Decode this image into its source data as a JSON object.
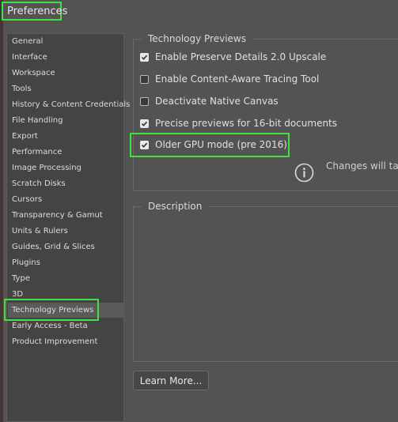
{
  "window": {
    "title": "Preferences"
  },
  "sidebar": {
    "items": [
      {
        "label": "General"
      },
      {
        "label": "Interface"
      },
      {
        "label": "Workspace"
      },
      {
        "label": "Tools"
      },
      {
        "label": "History & Content Credentials"
      },
      {
        "label": "File Handling"
      },
      {
        "label": "Export"
      },
      {
        "label": "Performance"
      },
      {
        "label": "Image Processing"
      },
      {
        "label": "Scratch Disks"
      },
      {
        "label": "Cursors"
      },
      {
        "label": "Transparency & Gamut"
      },
      {
        "label": "Units & Rulers"
      },
      {
        "label": "Guides, Grid & Slices"
      },
      {
        "label": "Plugins"
      },
      {
        "label": "Type"
      },
      {
        "label": "3D"
      },
      {
        "label": "Technology Previews",
        "selected": true
      },
      {
        "label": "Early Access - Beta"
      },
      {
        "label": "Product Improvement"
      }
    ]
  },
  "tech_previews": {
    "title": "Technology Previews",
    "options": [
      {
        "label": "Enable Preserve Details 2.0 Upscale",
        "checked": true
      },
      {
        "label": "Enable Content-Aware Tracing Tool",
        "checked": false
      },
      {
        "label": "Deactivate Native Canvas",
        "checked": false
      },
      {
        "label": "Precise previews for 16-bit documents",
        "checked": true
      },
      {
        "label": "Older GPU mode (pre 2016)",
        "checked": true
      }
    ],
    "info_text": "Changes will tak",
    "info_icon": "info-circle-icon"
  },
  "description": {
    "title": "Description"
  },
  "buttons": {
    "learn_more": "Learn More..."
  },
  "colors": {
    "highlight": "#3fe23f",
    "background": "#535353",
    "panel": "#444444"
  }
}
